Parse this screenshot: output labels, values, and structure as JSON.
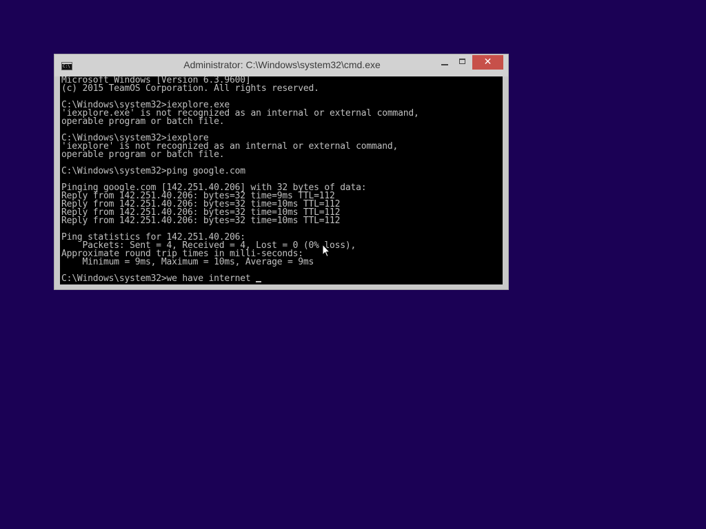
{
  "window": {
    "title": "Administrator: C:\\Windows\\system32\\cmd.exe",
    "close_label": "✕"
  },
  "console": {
    "lines": [
      "Microsoft Windows [Version 6.3.9600]",
      "(c) 2015 TeamOS Corporation. All rights reserved.",
      "",
      "C:\\Windows\\system32>iexplore.exe",
      "'iexplore.exe' is not recognized as an internal or external command,",
      "operable program or batch file.",
      "",
      "C:\\Windows\\system32>iexplore",
      "'iexplore' is not recognized as an internal or external command,",
      "operable program or batch file.",
      "",
      "C:\\Windows\\system32>ping google.com",
      "",
      "Pinging google.com [142.251.40.206] with 32 bytes of data:",
      "Reply from 142.251.40.206: bytes=32 time=9ms TTL=112",
      "Reply from 142.251.40.206: bytes=32 time=10ms TTL=112",
      "Reply from 142.251.40.206: bytes=32 time=10ms TTL=112",
      "Reply from 142.251.40.206: bytes=32 time=10ms TTL=112",
      "",
      "Ping statistics for 142.251.40.206:",
      "    Packets: Sent = 4, Received = 4, Lost = 0 (0% loss),",
      "Approximate round trip times in milli-seconds:",
      "    Minimum = 9ms, Maximum = 10ms, Average = 9ms",
      ""
    ],
    "current_input": "C:\\Windows\\system32>we have internet "
  },
  "colors": {
    "desktop": "#1b0155",
    "console_bg": "#000000",
    "console_fg": "#c0c0c0",
    "close_button": "#c7504a"
  },
  "icons": {
    "app": "cmd-icon",
    "minimize": "minimize-icon",
    "maximize": "maximize-icon",
    "close": "close-icon",
    "pointer": "mouse-pointer-icon"
  }
}
